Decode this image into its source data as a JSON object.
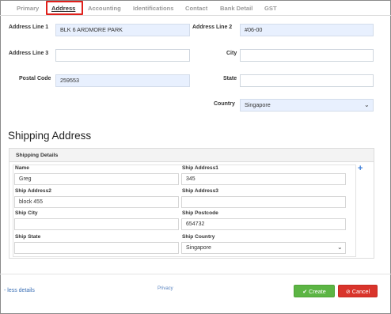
{
  "tabs": [
    {
      "label": "Primary"
    },
    {
      "label": "Address"
    },
    {
      "label": "Accounting"
    },
    {
      "label": "Identifications"
    },
    {
      "label": "Contact"
    },
    {
      "label": "Bank Detail"
    },
    {
      "label": "GST"
    }
  ],
  "address": {
    "line1_label": "Address Line 1",
    "line1_value": "BLK 6 ARDMORE PARK",
    "line2_label": "Address Line 2",
    "line2_value": "#06-00",
    "line3_label": "Address Line 3",
    "line3_value": "",
    "city_label": "City",
    "city_value": "",
    "postal_label": "Postal Code",
    "postal_value": "259553",
    "state_label": "State",
    "state_value": "",
    "country_label": "Country",
    "country_value": "Singapore"
  },
  "shipping": {
    "title": "Shipping Address",
    "panel_title": "Shipping Details",
    "name_label": "Name",
    "name_value": "Greg",
    "addr1_label": "Ship Address1",
    "addr1_value": "345",
    "addr2_label": "Ship Address2",
    "addr2_value": "block 455",
    "addr3_label": "Ship Address3",
    "addr3_value": "",
    "city_label": "Ship City",
    "city_value": "",
    "postcode_label": "Ship Postcode",
    "postcode_value": "654732",
    "state_label": "Ship State",
    "state_value": "",
    "country_label": "Ship Country",
    "country_value": "Singapore",
    "add_symbol": "+"
  },
  "footer": {
    "less_details": "- less details",
    "privacy": "Privacy",
    "create_label": "Create",
    "cancel_label": "Cancel"
  },
  "icons": {
    "create": "check-icon",
    "cancel": "ban-icon"
  },
  "colors": {
    "tab_highlight": "#e0201b",
    "filled_field": "#e8f0fe",
    "create_button": "#5cb544",
    "cancel_button": "#d9342b",
    "link": "#3a6fb5"
  }
}
